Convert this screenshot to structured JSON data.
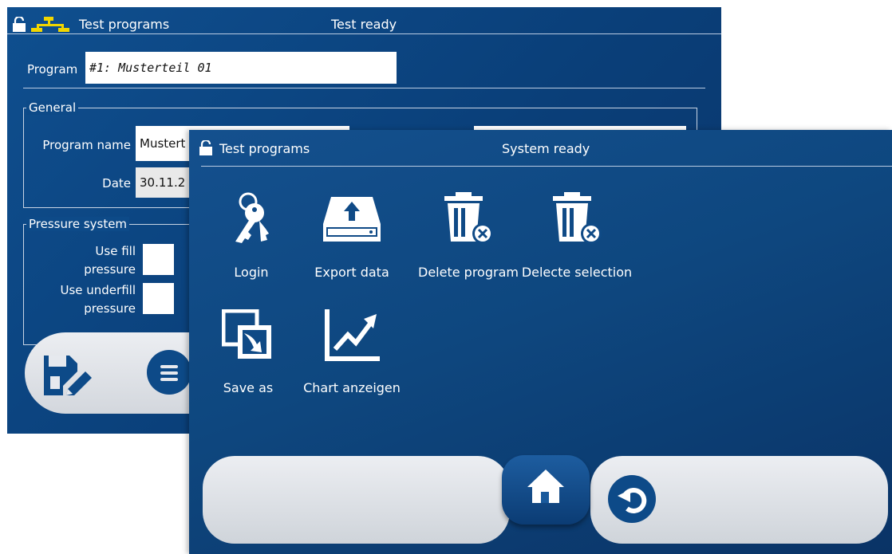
{
  "back_window": {
    "title": "Test programs",
    "status": "Test ready",
    "program_label": "Program",
    "program_value": "#1: Musterteil 01",
    "general_label": "General",
    "program_name_label": "Program name",
    "program_name_value": "Mustert",
    "date_label": "Date",
    "date_value": "30.11.2",
    "pressure_label": "Pressure system",
    "fill_label_1": "Use fill",
    "fill_label_2": "pressure",
    "underfill_label_1": "Use underfill",
    "underfill_label_2": "pressure",
    "icons": {
      "lock": "lock-open-icon",
      "network": "network-icon",
      "save": "save-edit-icon",
      "menu": "menu-icon"
    },
    "colors": {
      "background": "#0c4682",
      "network_icon": "#f2d600"
    }
  },
  "front_window": {
    "title": "Test programs",
    "status": "System ready",
    "tiles": [
      {
        "label": "Login",
        "icon": "keys-icon"
      },
      {
        "label": "Export data",
        "icon": "export-drive-icon"
      },
      {
        "label": "Delete program",
        "icon": "trash-delete-icon"
      },
      {
        "label": "Delecte selection",
        "icon": "trash-delete-selection-icon"
      },
      {
        "label": "Save as",
        "icon": "save-as-icon"
      },
      {
        "label": "Chart anzeigen",
        "icon": "chart-icon"
      }
    ],
    "bottom_icons": {
      "home": "home-icon",
      "back": "back-arrow-icon"
    },
    "colors": {
      "background": "#0f4a86",
      "bar": "#dfe2e6"
    }
  }
}
